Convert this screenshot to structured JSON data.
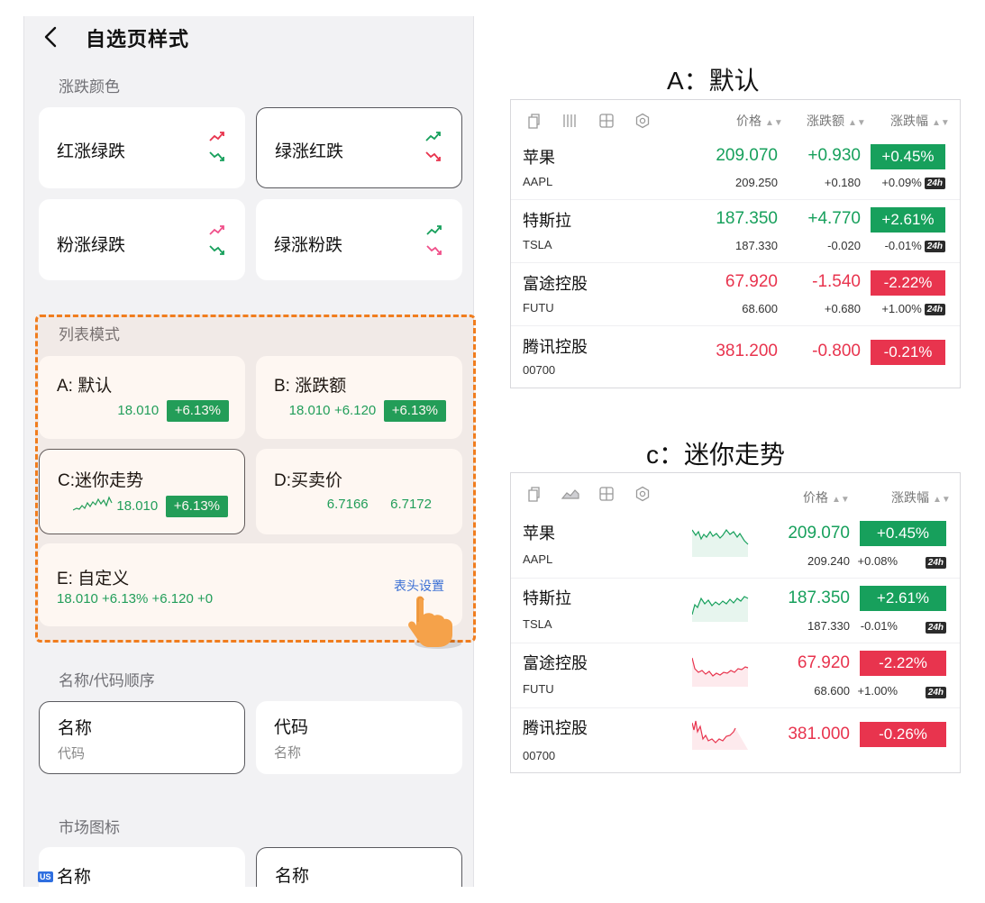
{
  "header": {
    "title": "自选页样式"
  },
  "color_section": {
    "title": "涨跌颜色",
    "options": [
      {
        "label": "红涨绿跌",
        "selected": false
      },
      {
        "label": "绿涨红跌",
        "selected": true
      },
      {
        "label": "粉涨绿跌",
        "selected": false
      },
      {
        "label": "绿涨粉跌",
        "selected": false
      }
    ]
  },
  "list_section": {
    "title": "列表模式",
    "a": {
      "label": "A: 默认",
      "price": "18.010",
      "pct": "+6.13%"
    },
    "b": {
      "label": "B: 涨跌额",
      "price": "18.010",
      "chg": "+6.120",
      "pct": "+6.13%"
    },
    "c": {
      "label": "C:迷你走势",
      "price": "18.010",
      "pct": "+6.13%"
    },
    "d": {
      "label": "D:买卖价",
      "bid": "6.7166",
      "ask": "6.7172"
    },
    "e": {
      "label": "E: 自定义",
      "values": "18.010 +6.13% +6.120 +0",
      "link": "表头设置"
    }
  },
  "order_section": {
    "title": "名称/代码顺序",
    "opt1": {
      "top": "名称",
      "bottom": "代码"
    },
    "opt2": {
      "top": "代码",
      "bottom": "名称"
    }
  },
  "market_section": {
    "title": "市场图标",
    "opt1": {
      "badge": "US",
      "label": "名称"
    },
    "opt2": {
      "label": "名称"
    }
  },
  "preview_a": {
    "caption": "A：默认",
    "headers": {
      "price": "价格",
      "chg": "涨跌额",
      "pct": "涨跌幅"
    },
    "rows": [
      {
        "name": "苹果",
        "code": "AAPL",
        "price": "209.070",
        "chg": "+0.930",
        "pct": "+0.45%",
        "sub_price": "209.250",
        "sub_chg": "+0.180",
        "sub_pct": "+0.09%",
        "badge": "24h",
        "dir": "up"
      },
      {
        "name": "特斯拉",
        "code": "TSLA",
        "price": "187.350",
        "chg": "+4.770",
        "pct": "+2.61%",
        "sub_price": "187.330",
        "sub_chg": "-0.020",
        "sub_pct": "-0.01%",
        "badge": "24h",
        "dir": "up"
      },
      {
        "name": "富途控股",
        "code": "FUTU",
        "price": "67.920",
        "chg": "-1.540",
        "pct": "-2.22%",
        "sub_price": "68.600",
        "sub_chg": "+0.680",
        "sub_pct": "+1.00%",
        "badge": "24h",
        "dir": "dn"
      },
      {
        "name": "腾讯控股",
        "code": "00700",
        "price": "381.200",
        "chg": "-0.800",
        "pct": "-0.21%",
        "dir": "dn"
      }
    ]
  },
  "preview_c": {
    "caption": "c：迷你走势",
    "headers": {
      "price": "价格",
      "pct": "涨跌幅"
    },
    "rows": [
      {
        "name": "苹果",
        "code": "AAPL",
        "price": "209.070",
        "pct": "+0.45%",
        "sub_price": "209.240",
        "sub_pct": "+0.08%",
        "badge": "24h",
        "dir": "up"
      },
      {
        "name": "特斯拉",
        "code": "TSLA",
        "price": "187.350",
        "pct": "+2.61%",
        "sub_price": "187.330",
        "sub_pct": "-0.01%",
        "badge": "24h",
        "dir": "up"
      },
      {
        "name": "富途控股",
        "code": "FUTU",
        "price": "67.920",
        "pct": "-2.22%",
        "sub_price": "68.600",
        "sub_pct": "+1.00%",
        "badge": "24h",
        "dir": "dn"
      },
      {
        "name": "腾讯控股",
        "code": "00700",
        "price": "381.000",
        "pct": "-0.26%",
        "dir": "dn"
      }
    ]
  },
  "colors": {
    "up": "#17a05c",
    "down": "#e8344e",
    "pink": "#f0508a",
    "highlight": "#f07d1e",
    "link": "#2f6fe0"
  }
}
